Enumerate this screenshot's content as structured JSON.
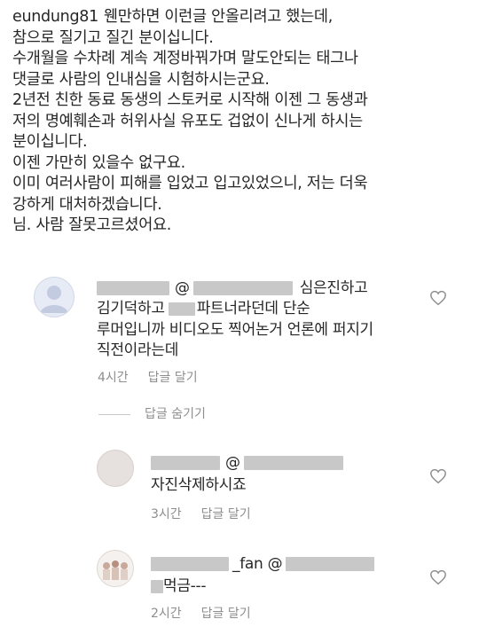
{
  "post": {
    "username": "eundung81",
    "lines": [
      "웬만하면 이런글 안올리려고 했는데,",
      "참으로 질기고 질긴 분이십니다.",
      "수개월을 수차례 계속 계정바꿔가며 말도안되는 태그나",
      "댓글로 사람의 인내심을 시험하시는군요.",
      "2년전 친한 동료 동생의 스토커로 시작해 이젠 그 동생과",
      "저의 명예훼손과 허위사실 유포도 겁없이 신나게 하시는",
      "분이십니다.",
      "이젠 가만히 있을수 없구요.",
      "이미 여러사람이 피해를 입었고 입고있었으니, 저는 더욱",
      "강하게 대처하겠습니다.",
      "님. 사람 잘못고르셨어요."
    ]
  },
  "comments": [
    {
      "mention_at": "@",
      "text_first": "심은진하고",
      "lines": [
        "김기덕하고",
        "파트너라던데 단순",
        "루머입니까 비디오도 찍어논거 언론에 퍼지기",
        "직전이라는데"
      ],
      "time": "4시간",
      "reply": "답글 달기"
    },
    {
      "mention_at": "@",
      "lines": [
        "자진삭제하시죠"
      ],
      "time": "3시간",
      "reply": "답글 달기"
    },
    {
      "name_suffix": "_fan @",
      "lines": [
        "먹금---"
      ],
      "time": "2시간",
      "reply": "답글 달기"
    }
  ],
  "hide_replies": "답글 숨기기",
  "colors": {
    "text": "#262626",
    "meta": "#8e8e8e",
    "redacted": "#c8c8c8"
  },
  "icons": [
    "heart-icon",
    "avatar-placeholder-icon"
  ]
}
